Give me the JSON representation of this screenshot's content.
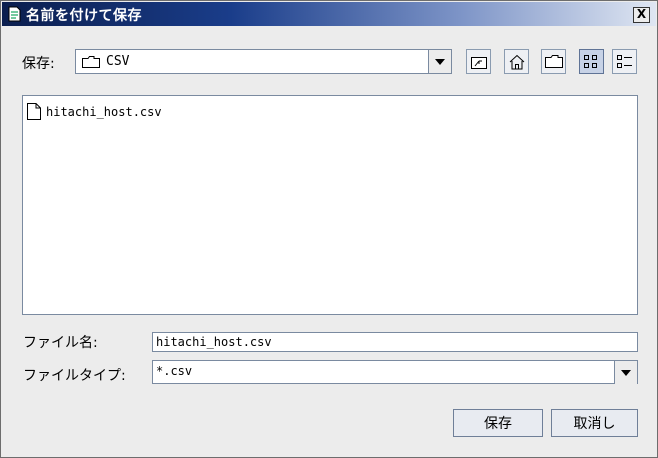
{
  "window": {
    "title": "名前を付けて保存",
    "close_symbol": "X"
  },
  "save_in": {
    "label": "保存:",
    "current_folder": "CSV"
  },
  "files": [
    {
      "name": "hitachi_host.csv"
    }
  ],
  "file_name": {
    "label": "ファイル名:",
    "value": "hitachi_host.csv"
  },
  "file_type": {
    "label": "ファイルタイプ:",
    "value": "*.csv"
  },
  "buttons": {
    "save": "保存",
    "cancel": "取消し"
  },
  "colors": {
    "title_start": "#0b1e4e",
    "title_end": "#dfe6f2",
    "background": "#ececec"
  }
}
